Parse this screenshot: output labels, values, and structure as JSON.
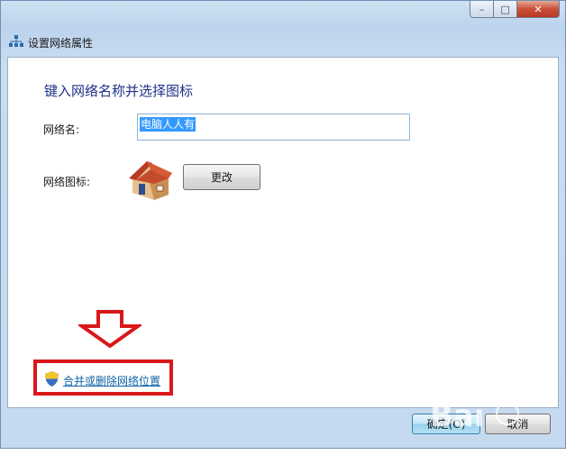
{
  "window": {
    "title": "设置网络属性",
    "minimize_glyph": "–",
    "maximize_glyph": "□",
    "close_glyph": "✕"
  },
  "content": {
    "heading": "键入网络名称并选择图标",
    "network_name_label": "网络名:",
    "network_name_value": "电脑人人有",
    "network_icon_label": "网络图标:",
    "change_button": "更改",
    "merge_link": "合并或删除网络位置"
  },
  "footer": {
    "ok_button": "确定(O)",
    "cancel_button": "取消"
  },
  "colors": {
    "accent_red": "#d9181b",
    "link_blue": "#1064a8",
    "heading_blue": "#1e3287"
  }
}
